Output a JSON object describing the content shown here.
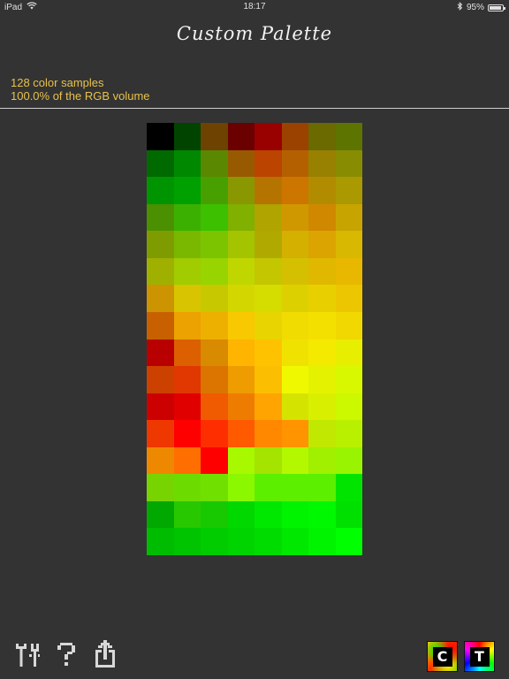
{
  "status_bar": {
    "device": "iPad",
    "time": "18:17",
    "battery": "95%",
    "battery_level": 0.95
  },
  "nav": {
    "title": "Custom Palette"
  },
  "info": {
    "samples_line": "128 color samples",
    "volume_line": "100.0% of the RGB volume"
  },
  "palette": {
    "columns": 8,
    "colors": [
      "#000000",
      "#004400",
      "#6e4200",
      "#6a0000",
      "#990000",
      "#9c4200",
      "#6a6a00",
      "#5e7400",
      "#006a00",
      "#008800",
      "#5a8800",
      "#985a00",
      "#bb4400",
      "#b56000",
      "#988000",
      "#888c00",
      "#009400",
      "#00a000",
      "#48a000",
      "#899800",
      "#b57400",
      "#cc7600",
      "#b28c00",
      "#aa9900",
      "#4a9000",
      "#3cb000",
      "#3cc000",
      "#80b000",
      "#b0a400",
      "#d09800",
      "#d08800",
      "#c8a400",
      "#7e9c00",
      "#7ab800",
      "#7cc400",
      "#a4c400",
      "#b0aa00",
      "#d4b000",
      "#dca400",
      "#d8b800",
      "#a0b000",
      "#a0cc00",
      "#98d400",
      "#c0d600",
      "#c4c600",
      "#d4c000",
      "#e0b800",
      "#e8b800",
      "#cc9400",
      "#d8c400",
      "#c8c800",
      "#d4d600",
      "#d4dc00",
      "#dcd000",
      "#e8d000",
      "#ecc600",
      "#c86000",
      "#eca200",
      "#eeb000",
      "#f8c800",
      "#e8d400",
      "#f0dc00",
      "#f4e000",
      "#f0d800",
      "#b80000",
      "#dc6000",
      "#d88a00",
      "#ffb400",
      "#ffc200",
      "#f0e200",
      "#f4ea00",
      "#e8ee00",
      "#cc4000",
      "#e03800",
      "#dc7400",
      "#ee9c00",
      "#fcbe00",
      "#f0f800",
      "#e4f200",
      "#d8f800",
      "#cc0000",
      "#e00000",
      "#f05a00",
      "#ee7c00",
      "#ffa400",
      "#d4e400",
      "#d8f000",
      "#ccf800",
      "#ee3800",
      "#ff0000",
      "#ff2e00",
      "#ff5a00",
      "#ff8800",
      "#ff9400",
      "#c0e800",
      "#b8f000",
      "#ee8800",
      "#ff6e00",
      "#ff0000",
      "#a8f800",
      "#a4e400",
      "#b4f800",
      "#a0f000",
      "#98f400",
      "#78d400",
      "#6cdc00",
      "#70e000",
      "#8cf800",
      "#5cf000",
      "#5cf000",
      "#5cf000",
      "#00e400",
      "#00a800",
      "#28c800",
      "#18c800",
      "#00d800",
      "#00e800",
      "#00f400",
      "#00f800",
      "#00e000",
      "#00bc00",
      "#00c400",
      "#00cc00",
      "#00d400",
      "#00dc00",
      "#00e800",
      "#00f400",
      "#00ff00"
    ]
  },
  "toolbar": {
    "mode_c_label": "C",
    "mode_t_label": "T"
  },
  "colors": {
    "background": "#333333",
    "info_text": "#e8c14a",
    "title_text": "#f2f2f2",
    "icon": "#d8d8d8"
  }
}
